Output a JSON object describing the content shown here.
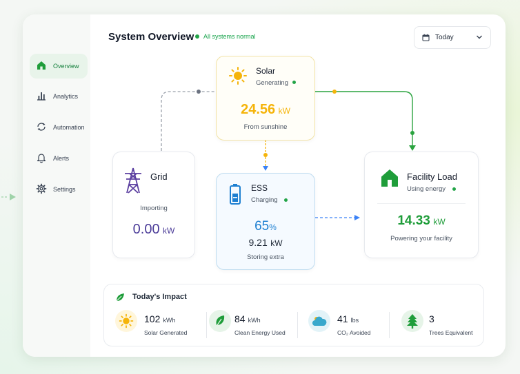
{
  "header": {
    "title": "System Overview",
    "status": "All systems normal",
    "date_range": "Today"
  },
  "sidebar": {
    "items": [
      {
        "label": "Overview",
        "icon": "home-icon",
        "active": true
      },
      {
        "label": "Analytics",
        "icon": "bar-chart-icon",
        "active": false
      },
      {
        "label": "Automation",
        "icon": "cycle-icon",
        "active": false
      },
      {
        "label": "Alerts",
        "icon": "bell-icon",
        "active": false
      },
      {
        "label": "Settings",
        "icon": "gear-icon",
        "active": false
      }
    ]
  },
  "solar": {
    "title": "Solar",
    "status": "Generating",
    "value": "24.56",
    "unit": "kW",
    "caption": "From sunshine",
    "icon": "sun-icon",
    "color": "#f5b40a"
  },
  "grid": {
    "title": "Grid",
    "status": "Importing",
    "value": "0.00",
    "unit": "kW",
    "icon": "transmission-tower-icon",
    "color": "#5b3fa0"
  },
  "ess": {
    "title": "ESS",
    "status": "Charging",
    "percent": "65",
    "percent_unit": "%",
    "value": "9.21",
    "unit": "kW",
    "caption": "Storing extra",
    "icon": "battery-icon",
    "color": "#1d7fd1"
  },
  "facility": {
    "title": "Facility Load",
    "status": "Using energy",
    "value": "14.33",
    "unit": "kW",
    "caption": "Powering your facility",
    "icon": "house-icon",
    "color": "#1f9d3a"
  },
  "impact": {
    "title": "Today's Impact",
    "items": [
      {
        "value": "102",
        "unit": "kWh",
        "label": "Solar Generated",
        "icon": "sun-icon"
      },
      {
        "value": "84",
        "unit": "kWh",
        "label": "Clean Energy Used",
        "icon": "leaf-icon"
      },
      {
        "value": "41",
        "unit": "lbs",
        "label": "CO₂ Avoided",
        "icon": "cloud-icon"
      },
      {
        "value": "3",
        "unit": "",
        "label": "Trees Equivalent",
        "icon": "tree-icon"
      }
    ]
  }
}
